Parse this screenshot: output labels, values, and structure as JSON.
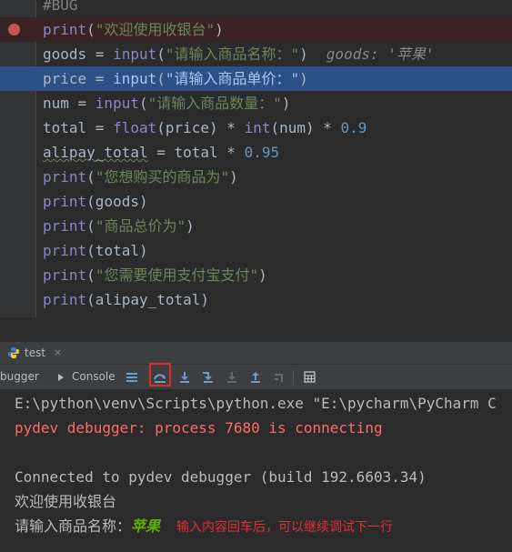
{
  "editor": {
    "lines": [
      {
        "id": "l0",
        "parts": [
          {
            "t": "#BUG",
            "c": "cmt"
          }
        ]
      },
      {
        "id": "l1",
        "breakpoint": true,
        "parts": [
          {
            "t": "print",
            "c": "kw-fn"
          },
          {
            "t": "(",
            "c": ""
          },
          {
            "t": "\"欢迎使用收银台\"",
            "c": "str"
          },
          {
            "t": ")",
            "c": ""
          }
        ]
      },
      {
        "id": "l2",
        "parts": [
          {
            "t": "goods = ",
            "c": ""
          },
          {
            "t": "input",
            "c": "kw-fn"
          },
          {
            "t": "(",
            "c": ""
          },
          {
            "t": "\"请输入商品名称：\"",
            "c": "str"
          },
          {
            "t": ")",
            "c": ""
          }
        ],
        "hint": "goods: '苹果'"
      },
      {
        "id": "l3",
        "current": true,
        "parts": [
          {
            "t": "price = ",
            "c": ""
          },
          {
            "t": "input",
            "c": "kw-fn"
          },
          {
            "t": "(",
            "c": ""
          },
          {
            "t": "\"请输入商品单价：\"",
            "c": "str"
          },
          {
            "t": ")",
            "c": ""
          }
        ]
      },
      {
        "id": "l4",
        "parts": [
          {
            "t": "num = ",
            "c": ""
          },
          {
            "t": "input",
            "c": "kw-fn"
          },
          {
            "t": "(",
            "c": ""
          },
          {
            "t": "\"请输入商品数量：\"",
            "c": "str"
          },
          {
            "t": ")",
            "c": ""
          }
        ]
      },
      {
        "id": "l5",
        "parts": [
          {
            "t": "total = ",
            "c": ""
          },
          {
            "t": "float",
            "c": "kw-fn"
          },
          {
            "t": "(price) * ",
            "c": ""
          },
          {
            "t": "int",
            "c": "kw-fn"
          },
          {
            "t": "(num) * ",
            "c": ""
          },
          {
            "t": "0.9",
            "c": "num"
          }
        ]
      },
      {
        "id": "l6",
        "parts": [
          {
            "t": "alipay_total",
            "c": "squiggle"
          },
          {
            "t": " = total * ",
            "c": ""
          },
          {
            "t": "0.95",
            "c": "num"
          }
        ]
      },
      {
        "id": "l7",
        "parts": [
          {
            "t": "print",
            "c": "kw-fn"
          },
          {
            "t": "(",
            "c": ""
          },
          {
            "t": "\"您想购买的商品为\"",
            "c": "str"
          },
          {
            "t": ")",
            "c": ""
          }
        ]
      },
      {
        "id": "l8",
        "parts": [
          {
            "t": "print",
            "c": "kw-fn"
          },
          {
            "t": "(goods)",
            "c": ""
          }
        ]
      },
      {
        "id": "l9",
        "parts": [
          {
            "t": "print",
            "c": "kw-fn"
          },
          {
            "t": "(",
            "c": ""
          },
          {
            "t": "\"商品总价为\"",
            "c": "str"
          },
          {
            "t": ")",
            "c": ""
          }
        ]
      },
      {
        "id": "l10",
        "parts": [
          {
            "t": "print",
            "c": "kw-fn"
          },
          {
            "t": "(total)",
            "c": ""
          }
        ]
      },
      {
        "id": "l11",
        "parts": [
          {
            "t": "print",
            "c": "kw-fn"
          },
          {
            "t": "(",
            "c": ""
          },
          {
            "t": "\"您需要使用支付宝支付\"",
            "c": "str"
          },
          {
            "t": ")",
            "c": ""
          }
        ]
      },
      {
        "id": "l12",
        "parts": [
          {
            "t": "print",
            "c": "kw-fn"
          },
          {
            "t": "(alipay_total)",
            "c": ""
          }
        ]
      }
    ]
  },
  "run_tab": {
    "label": "test",
    "close": "×"
  },
  "toolbar": {
    "debugger_label": "bugger",
    "console_label": "Console"
  },
  "console": {
    "cmd": "E:\\python\\venv\\Scripts\\python.exe \"E:\\pycharm\\PyCharm C",
    "debug_msg": "pydev debugger: process 7680 is connecting",
    "connected": "Connected to pydev debugger (build 192.6603.34)",
    "out1": "欢迎使用收银台",
    "prompt": "请输入商品名称：",
    "input_value": "苹果",
    "annotation": "输入内容回车后，可以继续调试下一行"
  },
  "colors": {
    "breakpoint": "#c75450",
    "current_line": "#2d5087",
    "annotation": "#e03030",
    "highlight_box": "#e02b2b"
  }
}
